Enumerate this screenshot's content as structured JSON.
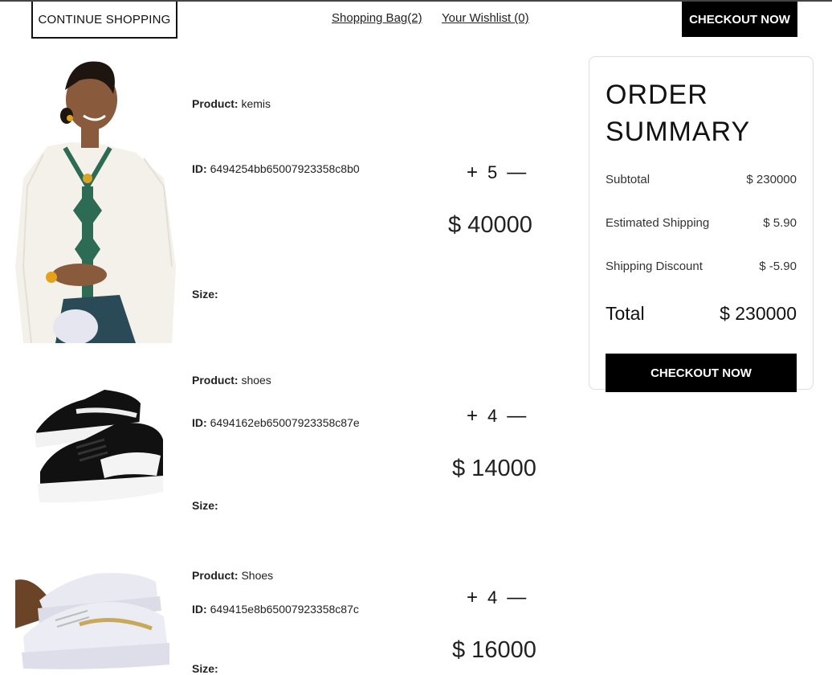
{
  "header": {
    "continue_label": "CONTINUE SHOPPING",
    "bag_label": "Shopping Bag(2)",
    "wishlist_label": "Your Wishlist (0)",
    "checkout_label": "CHECKOUT NOW"
  },
  "products": [
    {
      "product_label": "Product:",
      "product_value": "kemis",
      "id_label": "ID:",
      "id_value": "6494254bb65007923358c8b0",
      "size_label": "Size:",
      "qty": "5",
      "price": "$ 40000",
      "image": "woman-in-white-kemis-dress"
    },
    {
      "product_label": "Product:",
      "product_value": "shoes",
      "id_label": "ID:",
      "id_value": "6494162eb65007923358c87e",
      "size_label": "Size:",
      "qty": "4",
      "price": "$ 14000",
      "image": "black-suede-sneakers"
    },
    {
      "product_label": "Product:",
      "product_value": "Shoes",
      "id_label": "ID:",
      "id_value": "649415e8b65007923358c87c",
      "size_label": "Size:",
      "qty": "4",
      "price": "$ 16000",
      "image": "white-platform-sneakers"
    }
  ],
  "qty_controls": {
    "plus": "+",
    "minus": "—"
  },
  "summary": {
    "title_line1": "ORDER",
    "title_line2": "SUMMARY",
    "rows": [
      {
        "label": "Subtotal",
        "value": "$ 230000"
      },
      {
        "label": "Estimated Shipping",
        "value": "$ 5.90"
      },
      {
        "label": "Shipping Discount",
        "value": "$ -5.90"
      }
    ],
    "total_label": "Total",
    "total_value": "$ 230000",
    "checkout_label": "CHECKOUT NOW"
  },
  "colors": {
    "primary": "#000000",
    "background": "#ffffff",
    "card_border": "#dddddd"
  }
}
